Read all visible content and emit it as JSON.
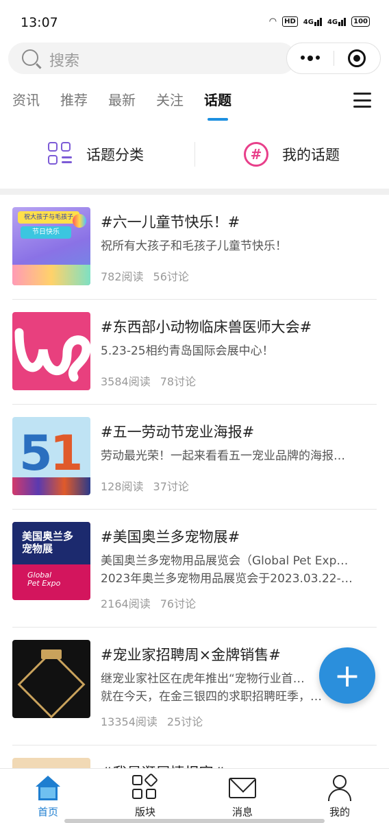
{
  "status": {
    "time": "13:07",
    "hd": "HD",
    "net1": "4G",
    "net2": "4G",
    "battery": "100"
  },
  "search": {
    "placeholder": "搜索"
  },
  "tabs": [
    {
      "label": "资讯"
    },
    {
      "label": "推荐"
    },
    {
      "label": "最新"
    },
    {
      "label": "关注"
    },
    {
      "label": "话题",
      "active": true
    }
  ],
  "quick": {
    "category_label": "话题分类",
    "my_topics_label": "我的话题",
    "hash": "#"
  },
  "topics": [
    {
      "title": "#六一儿童节快乐！#",
      "desc": [
        "祝所有大孩子和毛孩子儿童节快乐！"
      ],
      "reads": "782阅读",
      "comments": "56讨论",
      "thumb_text_1": "祝大孩子与毛孩子",
      "thumb_text_2": "节日快乐"
    },
    {
      "title": "#东西部小动物临床兽医师大会#",
      "desc": [
        "5.23-25相约青岛国际会展中心！"
      ],
      "reads": "3584阅读",
      "comments": "78讨论"
    },
    {
      "title": "#五一劳动节宠业海报#",
      "desc": [
        "劳动最光荣！一起来看看五一宠业品牌的海报…"
      ],
      "reads": "128阅读",
      "comments": "37讨论",
      "thumb_text_1": "5",
      "thumb_text_2": "1"
    },
    {
      "title": "#美国奥兰多宠物展#",
      "desc": [
        "美国奥兰多宠物用品展览会（Global Pet Exp…",
        "2023年奥兰多宠物用品展览会于2023.03.22-…"
      ],
      "reads": "2164阅读",
      "comments": "76讨论",
      "thumb_text_1": "美国奥兰多",
      "thumb_text_2": "宠物展",
      "thumb_text_3": "Global",
      "thumb_text_4": "Pet Expo"
    },
    {
      "title": "#宠业家招聘周×金牌销售#",
      "desc": [
        "继宠业家社区在虎年推出“宠物行业首…",
        "就在今天，在金三银四的求职招聘旺季，…"
      ],
      "reads": "13354阅读",
      "comments": "25讨论"
    },
    {
      "title": "#我是逛展情报官#",
      "desc": [],
      "reads": "",
      "comments": ""
    }
  ],
  "fab": {
    "label": "+"
  },
  "tabbar": [
    {
      "label": "首页",
      "active": true
    },
    {
      "label": "版块"
    },
    {
      "label": "消息"
    },
    {
      "label": "我的"
    }
  ],
  "colors": {
    "accent": "#1e7ed0",
    "fab": "#2b8fdc",
    "category_icon": "#7c5bd6",
    "hash_icon": "#e83f8a"
  }
}
